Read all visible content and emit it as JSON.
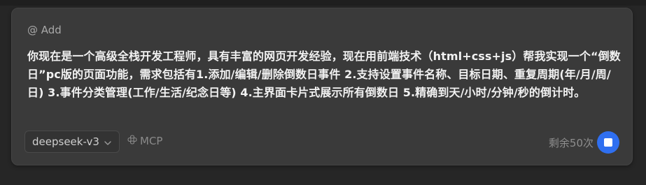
{
  "composer": {
    "mention_label": "@ Add",
    "prompt_text": "你现在是一个高级全栈开发工程师，具有丰富的网页开发经验，现在用前端技术（html+css+js）帮我实现一个“倒数日”pc版的页面功能，需求包括有1.添加/编辑/删除倒数日事件 2.支持设置事件名称、目标日期、重复周期(年/月/周/日) 3.事件分类管理(工作/生活/纪念日等) 4.主界面卡片式展示所有倒数日 5.精确到天/小时/分钟/秒的倒计时。",
    "model_selected": "deepseek-v3",
    "mcp_label": "MCP",
    "remaining_label": "剩余50次",
    "icons": {
      "model_dropdown": "chevron-down-icon",
      "mcp": "mcp-icon",
      "stop": "stop-icon"
    },
    "colors": {
      "accent": "#2f6ff0",
      "panel_bg": "#3a3a3a",
      "page_bg": "#262626"
    }
  }
}
